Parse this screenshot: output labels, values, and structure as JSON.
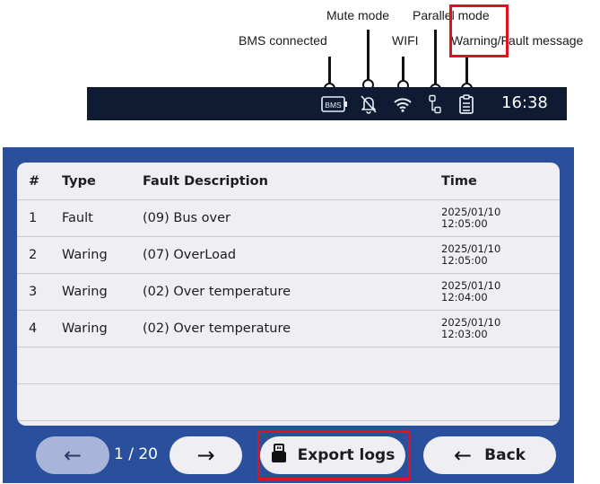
{
  "callouts": {
    "bms_connected": "BMS connected",
    "mute_mode": "Mute mode",
    "wifi": "WIFI",
    "parallel_mode": "Parallel mode",
    "warning_fault": "Warning/Fault message"
  },
  "status_bar": {
    "bms_icon_text": "BMS",
    "time": "16:38",
    "icons": [
      "bms-icon",
      "bell-muted-icon",
      "wifi-icon",
      "parallel-icon",
      "clipboard-icon"
    ]
  },
  "table": {
    "headers": {
      "num": "#",
      "type": "Type",
      "description": "Fault Description",
      "time": "Time"
    },
    "rows": [
      {
        "num": "1",
        "type": "Fault",
        "description": "(09) Bus over",
        "date": "2025/01/10",
        "clock": "12:05:00"
      },
      {
        "num": "2",
        "type": "Waring",
        "description": "(07) OverLoad",
        "date": "2025/01/10",
        "clock": "12:05:00"
      },
      {
        "num": "3",
        "type": "Waring",
        "description": "(02) Over temperature",
        "date": "2025/01/10",
        "clock": "12:04:00"
      },
      {
        "num": "4",
        "type": "Waring",
        "description": "(02) Over temperature",
        "date": "2025/01/10",
        "clock": "12:03:00"
      }
    ]
  },
  "footer": {
    "page_indicator": "1 / 20",
    "export_label": "Export logs",
    "back_label": "Back",
    "prev_arrow": "←",
    "next_arrow": "→",
    "back_arrow": "←"
  },
  "colors": {
    "status_bar": "#0f1a33",
    "screen_bg": "#2a4f9c",
    "panel_bg": "#eeeef3",
    "highlight": "#e0121d"
  }
}
